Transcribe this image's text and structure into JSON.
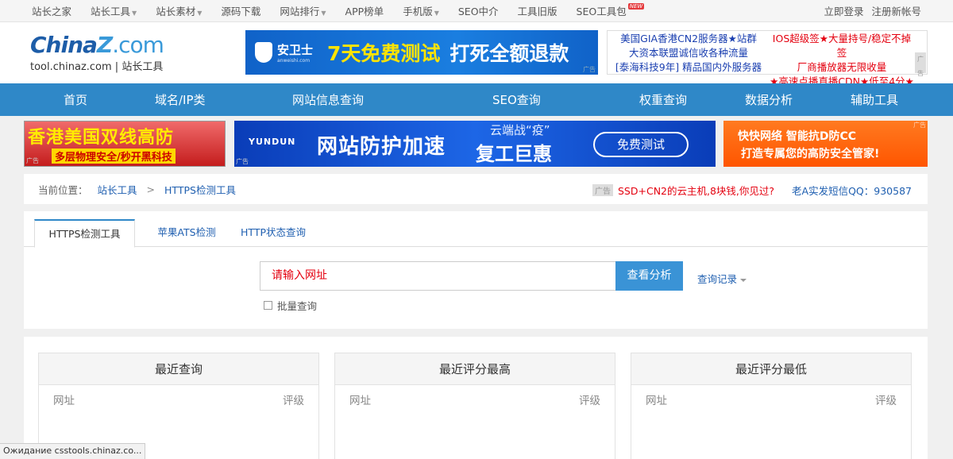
{
  "topbar": {
    "links": [
      {
        "label": "站长之家",
        "caret": false,
        "new": false
      },
      {
        "label": "站长工具",
        "caret": true,
        "new": false
      },
      {
        "label": "站长素材",
        "caret": true,
        "new": false
      },
      {
        "label": "源码下载",
        "caret": false,
        "new": false
      },
      {
        "label": "网站排行",
        "caret": true,
        "new": false
      },
      {
        "label": "APP榜单",
        "caret": false,
        "new": false
      },
      {
        "label": "手机版",
        "caret": true,
        "new": false
      },
      {
        "label": "SEO中介",
        "caret": false,
        "new": false
      },
      {
        "label": "工具旧版",
        "caret": false,
        "new": false
      },
      {
        "label": "SEO工具包",
        "caret": false,
        "new": true
      }
    ],
    "new_badge": "NEW",
    "login": "立即登录",
    "register": "注册新帐号"
  },
  "header": {
    "logo_china": "China",
    "logo_z": "Z",
    "logo_com": ".com",
    "logo_sub": "tool.chinaz.com | 站长工具",
    "ad_brand": "安卫士",
    "ad_brand_url": "anweishi.com",
    "ad_yellow": "7天免费测试",
    "ad_white": "打死全额退款",
    "ad_tag": "广告",
    "text_ads_left": [
      "美国GIA香港CN2服务器★站群",
      "大资本联盟诚信收各种流量",
      "[泰海科技9年] 精品国内外服务器"
    ],
    "text_ads_right": [
      "IOS超级签★大量持号/稳定不掉签",
      "厂商播放器无限收量",
      "★高速点播直播CDN★低至4分★"
    ]
  },
  "nav": [
    "首页",
    "域名/IP类",
    "网站信息查询",
    "SEO查询",
    "权重查询",
    "数据分析",
    "辅助工具"
  ],
  "banners": {
    "b1_title": "香港美国双线高防",
    "b1_sub": "多层物理安全/秒开黑科技",
    "b2_logo": "YUNDUN",
    "b2_main": "网站防护加速",
    "b2_small": "云端战“疫”",
    "b2_big": "复工巨惠",
    "b2_btn": "免费测试",
    "b3_line1": "快快网络 智能抗D防CC",
    "b3_line2": "打造专属您的高防安全管家!",
    "ad_tag": "广告"
  },
  "breadcrumb": {
    "label": "当前位置：",
    "items": [
      "站长工具",
      "HTTPS检测工具"
    ],
    "ad_tag": "广告",
    "ad_text": "SSD+CN2的云主机,8块钱,你见过?",
    "contact": "老A实发短信QQ：930587"
  },
  "tool": {
    "tabs": [
      "HTTPS检测工具",
      "苹果ATS检测",
      "HTTP状态查询"
    ],
    "search_placeholder": "请输入网址",
    "search_button": "查看分析",
    "history": "查询记录",
    "batch": "批量查询"
  },
  "lists": [
    {
      "title": "最近查询",
      "col_url": "网址",
      "col_grade": "评级"
    },
    {
      "title": "最近评分最高",
      "col_url": "网址",
      "col_grade": "评级"
    },
    {
      "title": "最近评分最低",
      "col_url": "网址",
      "col_grade": "评级"
    }
  ],
  "status_bar": "Ожидание csstools.chinaz.co..."
}
